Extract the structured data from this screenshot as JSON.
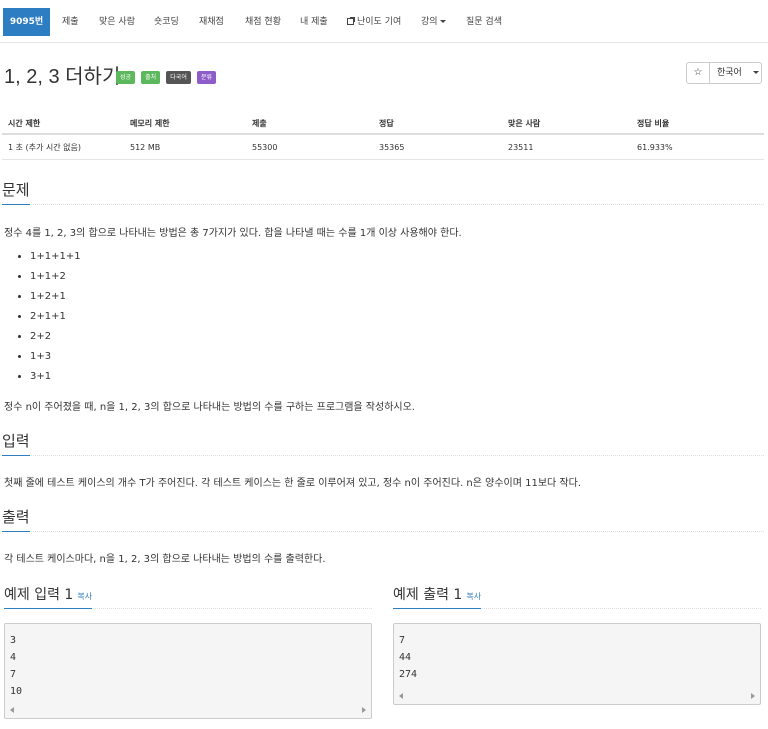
{
  "nav": {
    "tabs": [
      "9095번",
      "제출",
      "맞은 사람",
      "숏코딩",
      "재채점",
      "채점 현황",
      "내 제출",
      "난이도 기여",
      "강의",
      "질문 검색"
    ]
  },
  "problem": {
    "title": "1, 2, 3 더하기",
    "badges": [
      {
        "label": "성공",
        "color": "#5cb85c"
      },
      {
        "label": "출처",
        "color": "#5cb85c"
      },
      {
        "label": "다국어",
        "color": "#555555"
      },
      {
        "label": "분류",
        "color": "#8e5cc8"
      }
    ],
    "star_icon": "star-icon",
    "language": "한국어"
  },
  "stats": {
    "headers": [
      "시간 제한",
      "메모리 제한",
      "제출",
      "정답",
      "맞은 사람",
      "정답 비율"
    ],
    "values": [
      "1 초 (추가 시간 없음)",
      "512 MB",
      "55300",
      "35365",
      "23511",
      "61.933%"
    ]
  },
  "sections": {
    "problem_title": "문제",
    "problem_text1": "정수 4를 1, 2, 3의 합으로 나타내는 방법은 총 7가지가 있다. 합을 나타낼 때는 수를 1개 이상 사용해야 한다.",
    "list": [
      "1+1+1+1",
      "1+1+2",
      "1+2+1",
      "2+1+1",
      "2+2",
      "1+3",
      "3+1"
    ],
    "problem_text2": "정수 n이 주어졌을 때, n을 1, 2, 3의 합으로 나타내는 방법의 수를 구하는 프로그램을 작성하시오.",
    "input_title": "입력",
    "input_text": "첫째 줄에 테스트 케이스의 개수 T가 주어진다. 각 테스트 케이스는 한 줄로 이루어져 있고, 정수 n이 주어진다. n은 양수이며 11보다 작다.",
    "output_title": "출력",
    "output_text": "각 테스트 케이스마다, n을 1, 2, 3의 합으로 나타내는 방법의 수를 출력한다."
  },
  "examples": {
    "input_title": "예제 입력 1",
    "output_title": "예제 출력 1",
    "copy_label": "복사",
    "input_lines": [
      "3",
      "4",
      "7",
      "10"
    ],
    "output_lines": [
      "7",
      "44",
      "274"
    ]
  }
}
